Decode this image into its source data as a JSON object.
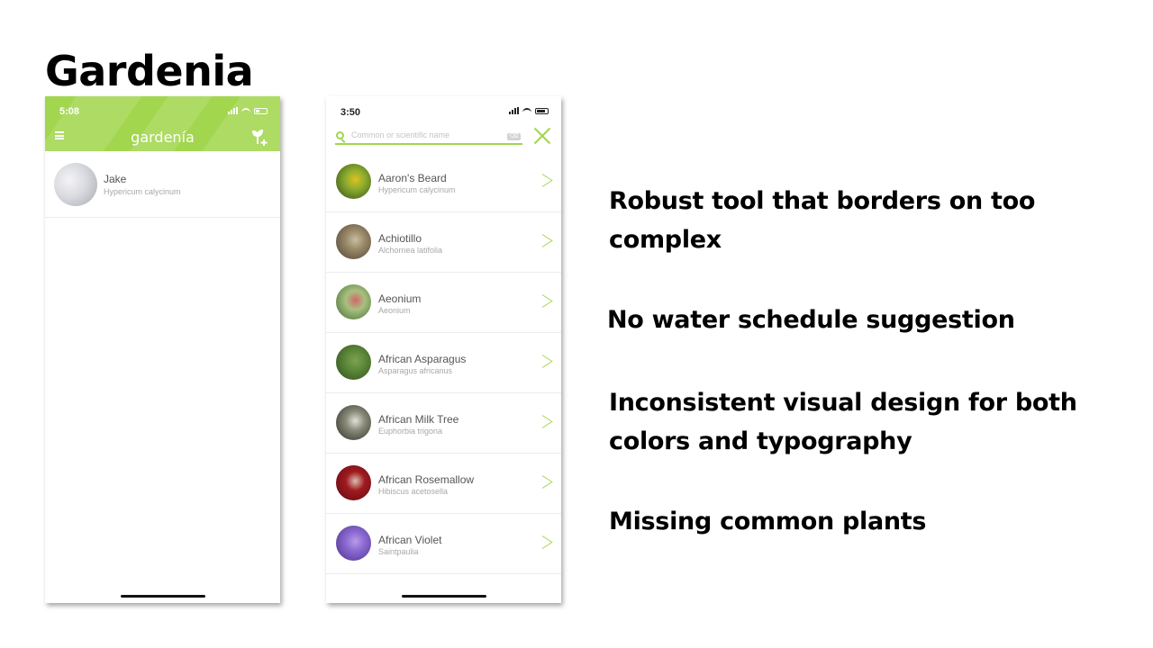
{
  "slide": {
    "title": "Gardenia"
  },
  "phone1": {
    "status_time": "5:08",
    "brand": "gardenía",
    "my_plants": [
      {
        "name": "Jake",
        "scientific": "Hypericum calycinum"
      }
    ]
  },
  "phone2": {
    "status_time": "3:50",
    "search": {
      "placeholder": "Common or scientific name",
      "clear_label": "⌫"
    },
    "plants": [
      {
        "name": "Aaron's Beard",
        "scientific": "Hypericum calycinum",
        "colors": [
          "#2e4a14",
          "#8fae2e",
          "#e0c020"
        ]
      },
      {
        "name": "Achiotillo",
        "scientific": "Alchornea latifolia",
        "colors": [
          "#4a3e30",
          "#9a8a6a",
          "#c8bea0"
        ]
      },
      {
        "name": "Aeonium",
        "scientific": "Aeonium",
        "colors": [
          "#3e6a30",
          "#a8c080",
          "#d06868"
        ]
      },
      {
        "name": "African Asparagus",
        "scientific": "Asparagus africanus",
        "colors": [
          "#2e4a1c",
          "#5e8a3a",
          "#7ea050"
        ]
      },
      {
        "name": "African Milk Tree",
        "scientific": "Euphorbia trigona",
        "colors": [
          "#2a2a22",
          "#8a8a7a",
          "#e0e0d8"
        ]
      },
      {
        "name": "African Rosemallow",
        "scientific": "Hibiscus acetosella",
        "colors": [
          "#5a0a10",
          "#a01a20",
          "#d8c0b0"
        ]
      },
      {
        "name": "African Violet",
        "scientific": "Saintpaulia",
        "colors": [
          "#4a2e8a",
          "#8a6ad0",
          "#b89ae8"
        ]
      }
    ]
  },
  "bullets": [
    {
      "line1": "Robust tool that borders on too",
      "line2": "complex"
    },
    {
      "line1": "No water schedule suggestion",
      "line2": ""
    },
    {
      "line1": "Inconsistent visual design for both",
      "line2": "colors and typography"
    },
    {
      "line1": "Missing common plants",
      "line2": ""
    }
  ],
  "colors": {
    "accent_green": "#a2d64e"
  }
}
